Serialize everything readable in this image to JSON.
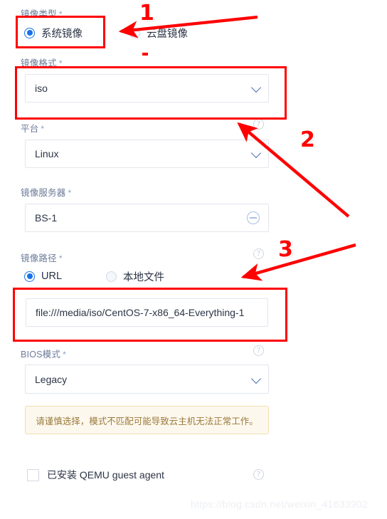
{
  "form": {
    "fields": [
      {
        "key": "image_type",
        "label": "镜像类型",
        "required_mark": "*",
        "type": "radio-group",
        "options": [
          "系统镜像",
          "云盘镜像"
        ],
        "selected": "系统镜像"
      },
      {
        "key": "image_format",
        "label": "镜像格式",
        "required_mark": "*",
        "type": "select",
        "value": "iso"
      },
      {
        "key": "platform",
        "label": "平台",
        "required_mark": "*",
        "type": "select",
        "value": "Linux",
        "has_help": true
      },
      {
        "key": "image_server",
        "label": "镜像服务器",
        "required_mark": "*",
        "type": "tag-input",
        "value": "BS-1"
      },
      {
        "key": "image_path",
        "label": "镜像路径",
        "required_mark": "*",
        "type": "radio-group+text",
        "options": [
          "URL",
          "本地文件"
        ],
        "selected": "URL",
        "value": "file:///media/iso/CentOS-7-x86_64-Everything-1",
        "has_help": true
      },
      {
        "key": "bios_mode",
        "label": "BIOS模式",
        "required_mark": "*",
        "type": "select",
        "value": "Legacy",
        "has_help": true
      }
    ],
    "warning": "请谨慎选择，模式不匹配可能导致云主机无法正常工作。",
    "checkbox": {
      "label": "已安装 QEMU guest agent",
      "checked": false,
      "has_help": true
    }
  },
  "annotations": {
    "numbers": [
      "1",
      "2",
      "3"
    ],
    "color": "#fe0000"
  },
  "watermark": "https://blog.csdn.net/weixin_41633902",
  "icons": {
    "help": "?",
    "caret": "chevron-down-icon",
    "minus": "minus-circle-icon"
  }
}
